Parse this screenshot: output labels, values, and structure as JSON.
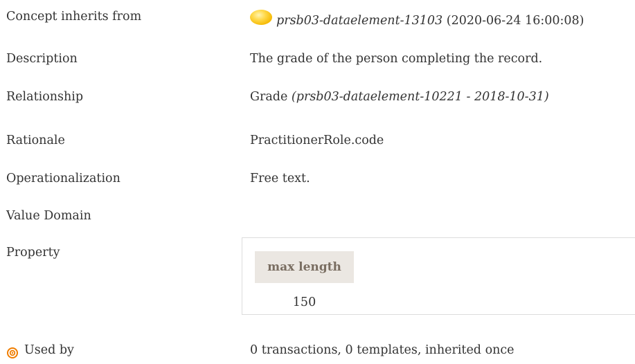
{
  "rows": {
    "inherits": {
      "label": "Concept inherits from",
      "icon": "yellow-orb-icon",
      "link_text": "prsb03-dataelement-13103",
      "timestamp": "(2020-06-24 16:00:08)"
    },
    "description": {
      "label": "Description",
      "value": "The grade of the person completing the record."
    },
    "relationship": {
      "label": "Relationship",
      "value": "Grade",
      "ref": "(prsb03-dataelement-10221 - 2018-10-31)"
    },
    "rationale": {
      "label": "Rationale",
      "value": "PractitionerRole.code"
    },
    "operationalization": {
      "label": "Operationalization",
      "value": "Free text."
    },
    "value_domain": {
      "label": "Value Domain"
    },
    "property": {
      "label": "Property",
      "header": "max length",
      "value": "150"
    },
    "used_by": {
      "label": "Used by",
      "icon": "target-icon",
      "value": "0 transactions, 0 templates, inherited once"
    }
  },
  "colors": {
    "text": "#333333",
    "property_header_bg": "#ebe7e2",
    "property_header_text": "#7a6e62",
    "target_icon": "#f07d00"
  }
}
